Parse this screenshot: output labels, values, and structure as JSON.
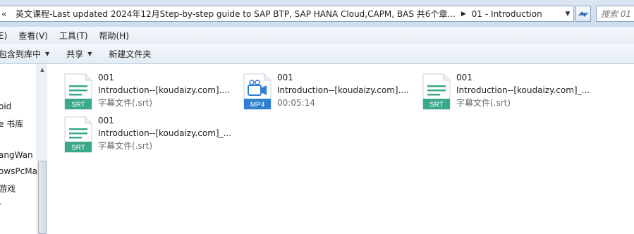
{
  "address": {
    "chevrons": "«",
    "crumbs": [
      "英文课程-Last updated 2024年12月Step-by-step guide to SAP BTP, SAP HANA Cloud,CAPM, BAS 共6个章...",
      "01 - Introduction"
    ],
    "search_placeholder": "搜索 01"
  },
  "menu": [
    "E)",
    "查看(V)",
    "工具(T)",
    "帮助(H)"
  ],
  "commands": [
    "包含到库中",
    "共享",
    "新建文件夹"
  ],
  "nav": {
    "items": [
      "oid",
      "e 书库",
      "angWan",
      "owsPcMa",
      "游戏",
      "-"
    ]
  },
  "files": [
    {
      "name": "001",
      "title": "Introduction--[koudaizy.com]....",
      "detail": "字幕文件(.srt)",
      "icon": "srt-file-icon",
      "badge": "SRT",
      "color": "#3aa88b"
    },
    {
      "name": "001",
      "title": "Introduction--[koudaizy.com]....",
      "detail": "00:05:14",
      "icon": "mp4-video-icon",
      "badge": "MP4",
      "color": "#2f7fd0"
    },
    {
      "name": "001",
      "title": "Introduction--[koudaizy.com]_...",
      "detail": "字幕文件(.srt)",
      "icon": "srt-file-icon",
      "badge": "SRT",
      "color": "#3aa88b"
    },
    {
      "name": "001",
      "title": "Introduction--[koudaizy.com]_...",
      "detail": "字幕文件(.srt)",
      "icon": "srt-file-icon",
      "badge": "SRT",
      "color": "#3aa88b"
    }
  ]
}
